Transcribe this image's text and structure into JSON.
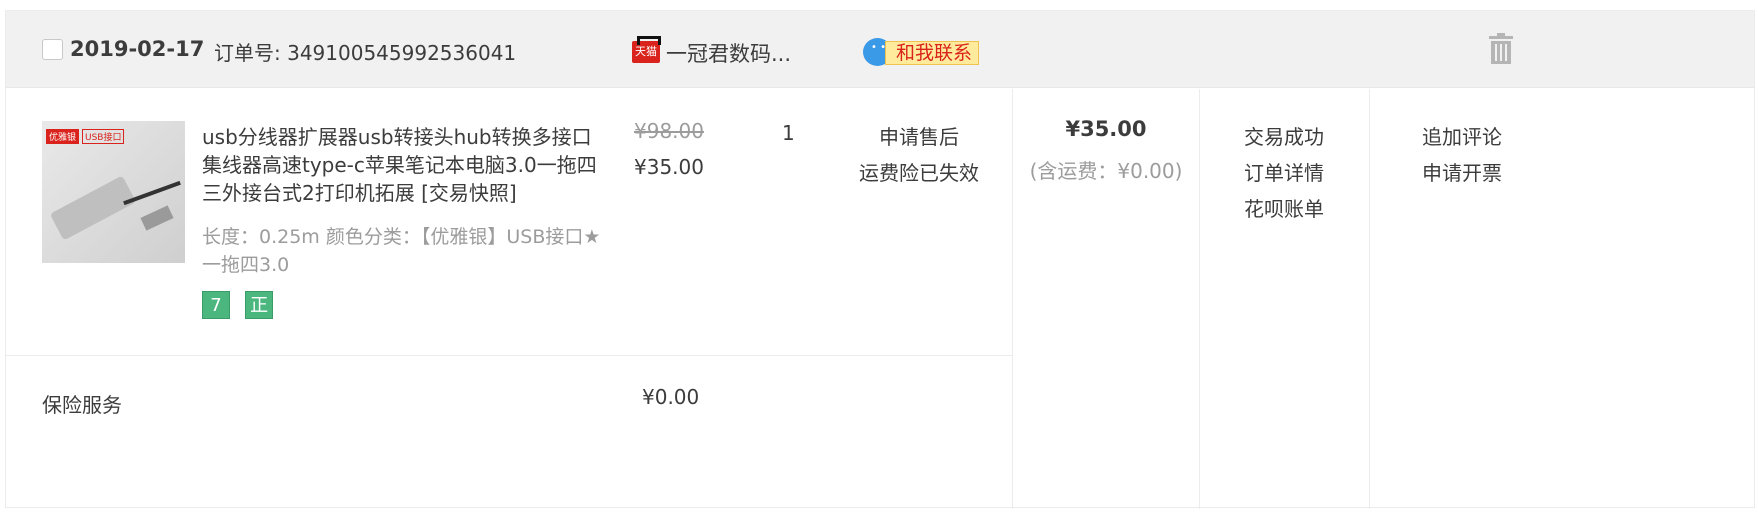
{
  "order": {
    "date": "2019-02-17",
    "order_no_label": "订单号: 349100545992536041",
    "shop_icon_text": "天猫",
    "shop_name": "一冠君数码...",
    "contact_label": "和我联系"
  },
  "product": {
    "image_tag1": "优雅银",
    "image_tag2": "USB接口",
    "title": "usb分线器扩展器usb转接头hub转换多接口集线器高速type-c苹果笔记本电脑3.0一拖四三外接台式2打印机拓展 [交易快照]",
    "spec": "长度：0.25m  颜色分类：【优雅银】USB接口★一拖四3.0",
    "badges": [
      "7",
      "正"
    ],
    "price_original": "¥98.00",
    "price_paid": "¥35.00",
    "quantity": "1",
    "after_sale": [
      "申请售后",
      "运费险已失效"
    ]
  },
  "totals": {
    "total": "¥35.00",
    "shipping": "(含运费：¥0.00)"
  },
  "status": [
    "交易成功",
    "订单详情",
    "花呗账单"
  ],
  "operations": [
    "追加评论",
    "申请开票"
  ],
  "insurance": {
    "label": "保险服务",
    "price": "¥0.00"
  }
}
